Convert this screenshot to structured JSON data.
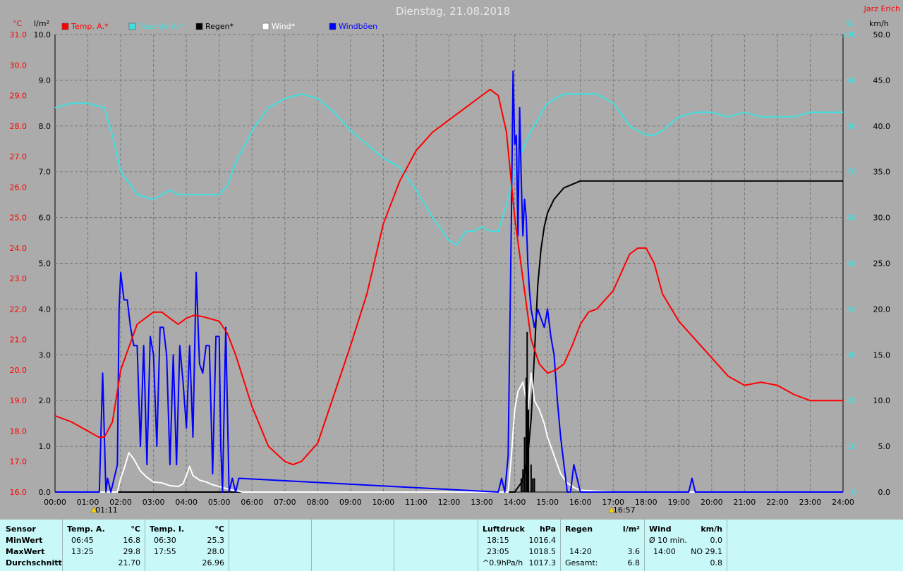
{
  "title": "Dienstag, 21.08.2018",
  "author": "Jarz Erich",
  "colors": {
    "bg": "#ababab",
    "temp": "#ff0000",
    "humidity": "#40e0e0",
    "rain": "#000000",
    "wind": "#ffffff",
    "gusts": "#0000ff"
  },
  "chart_data": {
    "type": "line",
    "title": "Dienstag, 21.08.2018",
    "x_ticks": [
      "00:00",
      "01:00",
      "02:00",
      "03:00",
      "04:00",
      "05:00",
      "06:00",
      "07:00",
      "08:00",
      "09:00",
      "10:00",
      "11:00",
      "12:00",
      "13:00",
      "14:00",
      "15:00",
      "16:00",
      "17:00",
      "18:00",
      "19:00",
      "20:00",
      "21:00",
      "22:00",
      "23:00",
      "24:00"
    ],
    "axes": {
      "temp": {
        "unit": "°C",
        "ticks": [
          "31.0",
          "30.0",
          "29.0",
          "28.0",
          "27.0",
          "26.0",
          "25.0",
          "24.0",
          "23.0",
          "22.0",
          "21.0",
          "20.0",
          "19.0",
          "18.0",
          "17.0",
          "16.0"
        ],
        "range": [
          16,
          31
        ]
      },
      "rain": {
        "unit": "l/m²",
        "ticks": [
          "10.0",
          "9.0",
          "8.0",
          "7.0",
          "6.0",
          "5.0",
          "4.0",
          "3.0",
          "2.0",
          "1.0",
          "0.0"
        ],
        "range": [
          0,
          10
        ]
      },
      "humidity": {
        "unit": "%",
        "ticks": [
          "100",
          "90",
          "80",
          "70",
          "60",
          "50",
          "40",
          "30",
          "20",
          "10",
          "0"
        ],
        "range": [
          0,
          100
        ]
      },
      "wind": {
        "unit": "km/h",
        "ticks": [
          "50.0",
          "45.0",
          "40.0",
          "35.0",
          "30.0",
          "25.0",
          "20.0",
          "15.0",
          "10.0",
          "5.0",
          "0.0"
        ],
        "range": [
          0,
          50
        ]
      }
    },
    "legend": [
      {
        "label": "Temp. A.*",
        "color": "#ff0000"
      },
      {
        "label": "Feuchte A.*",
        "color": "#40e0e0"
      },
      {
        "label": "Regen*",
        "color": "#000000"
      },
      {
        "label": "Wind*",
        "color": "#ffffff"
      },
      {
        "label": "Windböen",
        "color": "#0000ff"
      }
    ],
    "sun_markers": [
      "01:11",
      "16:57"
    ],
    "series": [
      {
        "name": "Temp. A.*",
        "axis": "temp",
        "color": "#ff0000",
        "x": [
          0,
          0.5,
          1,
          1.33,
          1.5,
          1.75,
          2,
          2.5,
          3,
          3.25,
          3.5,
          3.75,
          4,
          4.25,
          4.5,
          5,
          5.25,
          5.5,
          6,
          6.5,
          7,
          7.25,
          7.5,
          8,
          8.5,
          9,
          9.5,
          10,
          10.5,
          11,
          11.5,
          12,
          12.5,
          13,
          13.25,
          13.5,
          13.75,
          14,
          14.25,
          14.5,
          14.75,
          15,
          15.25,
          15.5,
          15.75,
          16,
          16.25,
          16.5,
          17,
          17.25,
          17.5,
          17.75,
          18,
          18.25,
          18.5,
          19,
          19.5,
          20,
          20.5,
          21,
          21.5,
          22,
          22.5,
          23,
          23.5,
          24
        ],
        "y": [
          18.5,
          18.3,
          18.0,
          17.8,
          17.8,
          18.3,
          20.0,
          21.5,
          21.9,
          21.9,
          21.7,
          21.5,
          21.7,
          21.8,
          21.75,
          21.6,
          21.2,
          20.5,
          18.8,
          17.5,
          17.0,
          16.9,
          17.0,
          17.6,
          19.2,
          20.8,
          22.5,
          24.8,
          26.2,
          27.2,
          27.8,
          28.2,
          28.6,
          29.0,
          29.2,
          29.0,
          27.8,
          25.0,
          23.0,
          21.0,
          20.2,
          19.9,
          20.0,
          20.2,
          20.8,
          21.5,
          21.9,
          22.0,
          22.6,
          23.2,
          23.8,
          24.0,
          24.0,
          23.5,
          22.5,
          21.6,
          21.0,
          20.4,
          19.8,
          19.5,
          19.6,
          19.5,
          19.2,
          19.0,
          19.0,
          19.0
        ]
      },
      {
        "name": "Feuchte A.*",
        "axis": "humidity",
        "color": "#40e0e0",
        "x": [
          0,
          0.5,
          1,
          1.5,
          1.75,
          2,
          2.5,
          3,
          3.25,
          3.5,
          3.75,
          4,
          4.25,
          4.5,
          5,
          5.25,
          5.5,
          6,
          6.5,
          7,
          7.5,
          8,
          8.5,
          9,
          9.5,
          10,
          10.5,
          11,
          11.5,
          12,
          12.25,
          12.5,
          12.75,
          13,
          13.25,
          13.5,
          13.75,
          14,
          14.25,
          14.5,
          14.75,
          15,
          15.5,
          16,
          16.5,
          17,
          17.5,
          18,
          18.25,
          18.5,
          19,
          19.5,
          20,
          20.5,
          21,
          21.5,
          22,
          22.5,
          23,
          23.5,
          24
        ],
        "y": [
          84,
          85,
          85,
          84,
          78,
          70,
          65,
          64,
          65,
          66,
          65,
          65,
          65,
          65,
          65,
          67,
          72,
          79,
          84,
          86,
          87,
          86,
          83,
          79,
          76,
          73,
          71,
          66,
          60,
          55,
          54,
          57,
          57,
          58,
          57,
          57,
          63,
          70,
          75,
          79,
          82,
          85,
          87,
          87,
          87,
          85,
          80,
          78,
          78,
          79,
          82,
          83,
          83,
          82,
          83,
          82,
          82,
          82,
          83,
          83,
          83
        ]
      },
      {
        "name": "Regen*",
        "axis": "rain",
        "color": "#000000",
        "x": [
          0,
          13.9,
          14.0,
          14.1,
          14.2,
          14.3,
          14.4,
          14.5,
          14.6,
          14.7,
          14.8,
          14.9,
          15.0,
          15.2,
          15.5,
          16.0,
          17.0,
          24.0
        ],
        "y": [
          0,
          0,
          0,
          0.1,
          0.2,
          0.4,
          0.8,
          1.6,
          3.0,
          4.5,
          5.3,
          5.8,
          6.1,
          6.4,
          6.65,
          6.8,
          6.8,
          6.8
        ]
      },
      {
        "name": "Wind*",
        "axis": "wind",
        "color": "#ffffff",
        "x": [
          0,
          1.9,
          2.0,
          2.1,
          2.25,
          2.4,
          2.6,
          2.8,
          3.0,
          3.25,
          3.5,
          3.75,
          3.9,
          4.0,
          4.1,
          4.2,
          4.4,
          4.6,
          4.8,
          5.0,
          5.2,
          5.4,
          5.6,
          5.7,
          13.8,
          13.9,
          14.0,
          14.1,
          14.25,
          14.4,
          14.5,
          14.6,
          14.75,
          14.9,
          15.0,
          15.2,
          15.4,
          15.6,
          15.8,
          16.0,
          16.5,
          17.0,
          24.0
        ],
        "y": [
          0,
          0,
          1.5,
          2.5,
          4.3,
          3.6,
          2.3,
          1.6,
          1.1,
          1.0,
          0.7,
          0.6,
          0.9,
          1.8,
          2.8,
          1.8,
          1.3,
          1.1,
          0.8,
          0.6,
          0.4,
          0.2,
          0.1,
          0,
          0,
          4,
          9,
          11,
          12,
          9,
          13,
          10,
          9,
          7.5,
          6,
          4,
          2,
          1,
          0.5,
          0.2,
          0.1,
          0,
          0
        ]
      },
      {
        "name": "Windböen",
        "axis": "wind",
        "color": "#0000ff",
        "x": [
          0,
          1.35,
          1.45,
          1.55,
          1.6,
          1.7,
          1.8,
          1.9,
          1.95,
          2.0,
          2.1,
          2.2,
          2.3,
          2.4,
          2.5,
          2.6,
          2.7,
          2.8,
          2.9,
          3.0,
          3.1,
          3.2,
          3.3,
          3.4,
          3.5,
          3.6,
          3.7,
          3.8,
          3.9,
          4.0,
          4.1,
          4.2,
          4.3,
          4.4,
          4.5,
          4.6,
          4.7,
          4.8,
          4.9,
          5.0,
          5.05,
          5.1,
          5.2,
          5.3,
          5.4,
          5.5,
          5.6,
          13.5,
          13.6,
          13.7,
          13.8,
          13.9,
          13.95,
          14.0,
          14.05,
          14.1,
          14.15,
          14.2,
          14.25,
          14.3,
          14.35,
          14.4,
          14.45,
          14.5,
          14.6,
          14.7,
          14.8,
          14.9,
          15.0,
          15.1,
          15.2,
          15.3,
          15.4,
          15.5,
          15.6,
          15.7,
          15.8,
          16.0,
          19.3,
          19.4,
          19.5,
          24.0
        ],
        "y": [
          0,
          0,
          13,
          0,
          1.5,
          0,
          1.5,
          3,
          20,
          24,
          21,
          21,
          18,
          16,
          16,
          5,
          16,
          3,
          17,
          15,
          5,
          18,
          18,
          15,
          3,
          15,
          3,
          16,
          12,
          7,
          16,
          6,
          24,
          14,
          13,
          16,
          16,
          2,
          17,
          17,
          5,
          0,
          18,
          0,
          1.5,
          0,
          1.5,
          0,
          1.5,
          0,
          4,
          30,
          46,
          38,
          39,
          28,
          42,
          34,
          28,
          32,
          30,
          25,
          22,
          20,
          18,
          20,
          19,
          18,
          20,
          17,
          15,
          10,
          6,
          3,
          0,
          0,
          3,
          0,
          0,
          1.5,
          0,
          0
        ]
      }
    ]
  },
  "table": {
    "sensor": {
      "header": "Sensor",
      "rows": [
        "MinWert",
        "MaxWert",
        "Durchschnitt"
      ]
    },
    "temp_a": {
      "header": "Temp. A.",
      "unit": "°C",
      "min_time": "06:45",
      "min_val": "16.8",
      "max_time": "13:25",
      "max_val": "29.8",
      "avg": "21.70"
    },
    "temp_i": {
      "header": "Temp. I.",
      "unit": "°C",
      "min_time": "06:30",
      "min_val": "25.3",
      "max_time": "17:55",
      "max_val": "28.0",
      "avg": "26.96"
    },
    "pressure": {
      "header": "Luftdruck",
      "unit": "hPa",
      "min_time": "18:15",
      "min_val": "1016.4",
      "max_time": "23:05",
      "max_val": "1018.5",
      "trend_label": "^0.9hPa/h",
      "trend_val": "1017.3"
    },
    "rain": {
      "header": "Regen",
      "unit": "l/m²",
      "max_time": "14:20",
      "max_val": "3.6",
      "total_label": "Gesamt:",
      "total_val": "6.8"
    },
    "wind": {
      "header": "Wind",
      "unit": "km/h",
      "avg_label": "Ø 10 min.",
      "avg_val": "0.0",
      "max_time": "14:00",
      "max_val": "NO 29.1",
      "last_val": "0.8"
    }
  }
}
